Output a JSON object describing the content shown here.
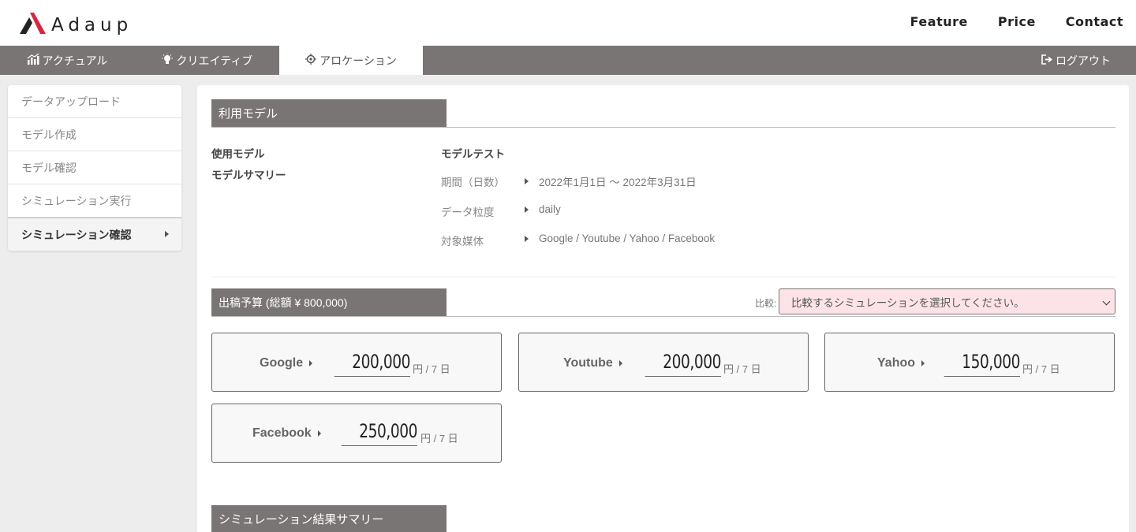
{
  "brand": {
    "name": "Adaup"
  },
  "topnav": {
    "feature": "Feature",
    "price": "Price",
    "contact": "Contact"
  },
  "tabs": [
    {
      "label": "アクチュアル",
      "icon": "chart-icon"
    },
    {
      "label": "クリエイティブ",
      "icon": "lightbulb-icon"
    },
    {
      "label": "アロケーション",
      "icon": "target-icon",
      "active": true
    }
  ],
  "logout": {
    "label": "ログアウト",
    "icon": "logout-icon"
  },
  "sidebar": {
    "items": [
      {
        "label": "データアップロード"
      },
      {
        "label": "モデル作成"
      },
      {
        "label": "モデル確認"
      },
      {
        "label": "シミュレーション実行"
      },
      {
        "label": "シミュレーション確認",
        "active": true
      }
    ]
  },
  "model_section": {
    "title": "利用モデル",
    "used_model_label": "使用モデル",
    "used_model_value": "モデルテスト",
    "summary_label": "モデルサマリー",
    "rows": [
      {
        "label": "期間（日数）",
        "value": "2022年1月1日 ～ 2022年3月31日"
      },
      {
        "label": "データ粒度",
        "value": "daily"
      },
      {
        "label": "対象媒体",
        "value": "Google / Youtube / Yahoo / Facebook"
      }
    ]
  },
  "budget_section": {
    "title": "出稿予算 (総額 ¥ 800,000)",
    "compare_label": "比較:",
    "compare_placeholder": "比較するシミュレーションを選択してください。",
    "cards": [
      {
        "name": "Google",
        "amount": "200,000",
        "unit": "円 / 7 日"
      },
      {
        "name": "Youtube",
        "amount": "200,000",
        "unit": "円 / 7 日"
      },
      {
        "name": "Yahoo",
        "amount": "150,000",
        "unit": "円 / 7 日"
      },
      {
        "name": "Facebook",
        "amount": "250,000",
        "unit": "円 / 7 日"
      }
    ]
  },
  "result_section": {
    "title": "シミュレーション結果サマリー"
  },
  "colors": {
    "accent_red": "#d7263d",
    "bar_gray": "#7a7575",
    "select_pink": "#fde3e8"
  }
}
